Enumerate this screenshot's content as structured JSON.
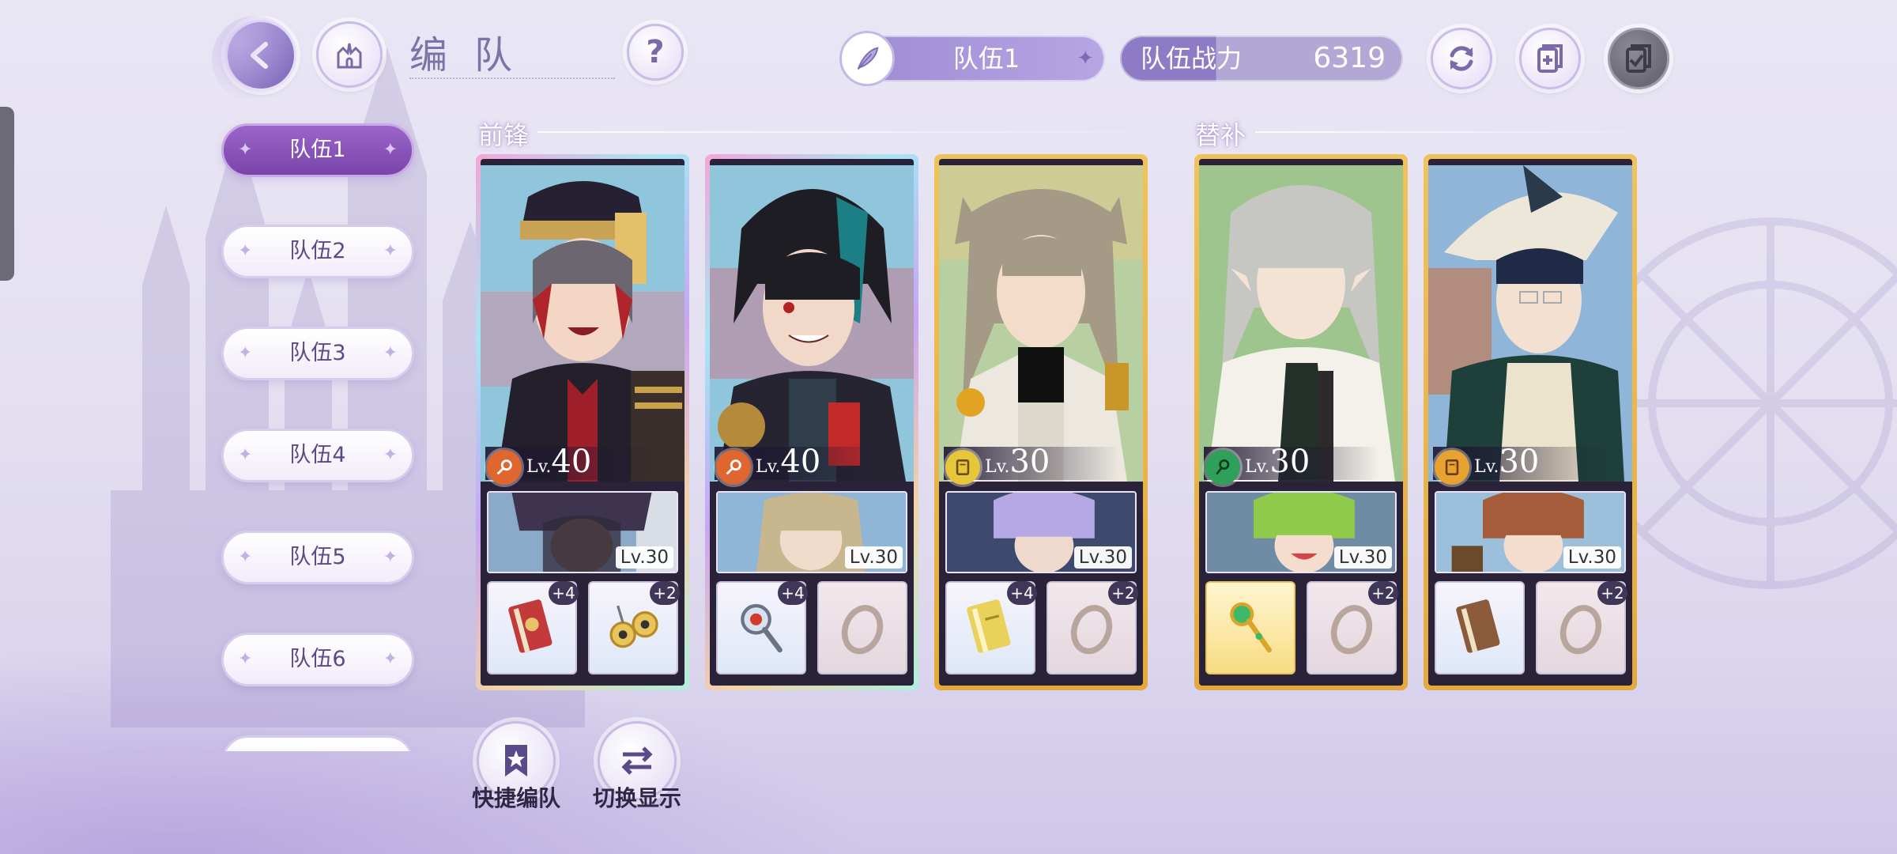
{
  "header": {
    "title": "编队",
    "back_icon": "back-arrow-icon",
    "home_icon": "castle-home-icon",
    "help_label": "?",
    "team_select": {
      "label": "队伍1",
      "icon": "feather-icon"
    },
    "power": {
      "label": "队伍战力",
      "value": "6319"
    },
    "actions": [
      {
        "name": "refresh",
        "icon": "refresh-icon"
      },
      {
        "name": "add-team",
        "icon": "add-document-icon"
      },
      {
        "name": "confirm",
        "icon": "check-docs-icon"
      }
    ]
  },
  "team_tabs": [
    "队伍1",
    "队伍2",
    "队伍3",
    "队伍4",
    "队伍5",
    "队伍6"
  ],
  "active_tab": "队伍1",
  "sections": {
    "front": "前锋",
    "sub": "替补"
  },
  "cards": [
    {
      "level_prefix": "Lv.",
      "level": "40",
      "element_color": "#e0662f",
      "support_level": "Lv.30",
      "equips": [
        {
          "icon": "red-book-icon",
          "badge": "+4"
        },
        {
          "icon": "bell-earring-icon",
          "badge": "+2"
        }
      ]
    },
    {
      "level_prefix": "Lv.",
      "level": "40",
      "element_color": "#e0662f",
      "support_level": "Lv.30",
      "equips": [
        {
          "icon": "magnifier-key-icon",
          "badge": "+4"
        },
        {
          "icon": "ring-icon",
          "badge": ""
        }
      ]
    },
    {
      "level_prefix": "Lv.",
      "level": "30",
      "element_color": "#e8c63a",
      "support_level": "Lv.30",
      "equips": [
        {
          "icon": "yellow-book-icon",
          "badge": "+4"
        },
        {
          "icon": "ring-icon",
          "badge": "+2"
        }
      ]
    },
    {
      "level_prefix": "Lv.",
      "level": "30",
      "element_color": "#2fa05a",
      "support_level": "Lv.30",
      "equips": [
        {
          "icon": "gem-scepter-icon",
          "badge": ""
        },
        {
          "icon": "ring-icon",
          "badge": "+2"
        }
      ]
    },
    {
      "level_prefix": "Lv.",
      "level": "30",
      "element_color": "#e8a22f",
      "support_level": "Lv.30",
      "equips": [
        {
          "icon": "brown-book-icon",
          "badge": ""
        },
        {
          "icon": "ring-icon",
          "badge": "+2"
        }
      ]
    }
  ],
  "bottom_actions": [
    {
      "label": "快捷编队",
      "icon": "bookmark-star-icon"
    },
    {
      "label": "切换显示",
      "icon": "swap-arrows-icon"
    }
  ],
  "colors": {
    "accent": "#8d7bc6",
    "active_tab": "#8a55b9"
  }
}
